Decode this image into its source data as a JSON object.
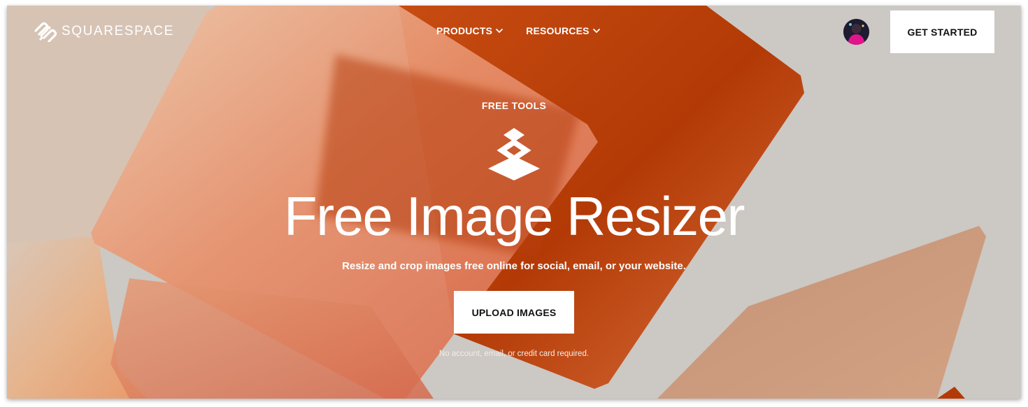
{
  "colors": {
    "background": "#ccc8c3",
    "accent_orange": "#b83c0a",
    "button_bg": "#ffffff",
    "text_light": "#ffffff"
  },
  "header": {
    "brand": "SQUARESPACE",
    "logo_icon": "squarespace-logo-icon",
    "nav": [
      {
        "label": "PRODUCTS",
        "icon": "chevron-down-icon"
      },
      {
        "label": "RESOURCES",
        "icon": "chevron-down-icon"
      }
    ],
    "avatar_icon": "user-avatar",
    "cta_label": "GET STARTED"
  },
  "hero": {
    "eyebrow": "FREE TOOLS",
    "tool_icon": "layers-icon",
    "title": "Free Image Resizer",
    "subtitle": "Resize and crop images free online for social, email, or your website.",
    "upload_label": "UPLOAD IMAGES",
    "disclaimer": "No account, email, or credit card required."
  }
}
